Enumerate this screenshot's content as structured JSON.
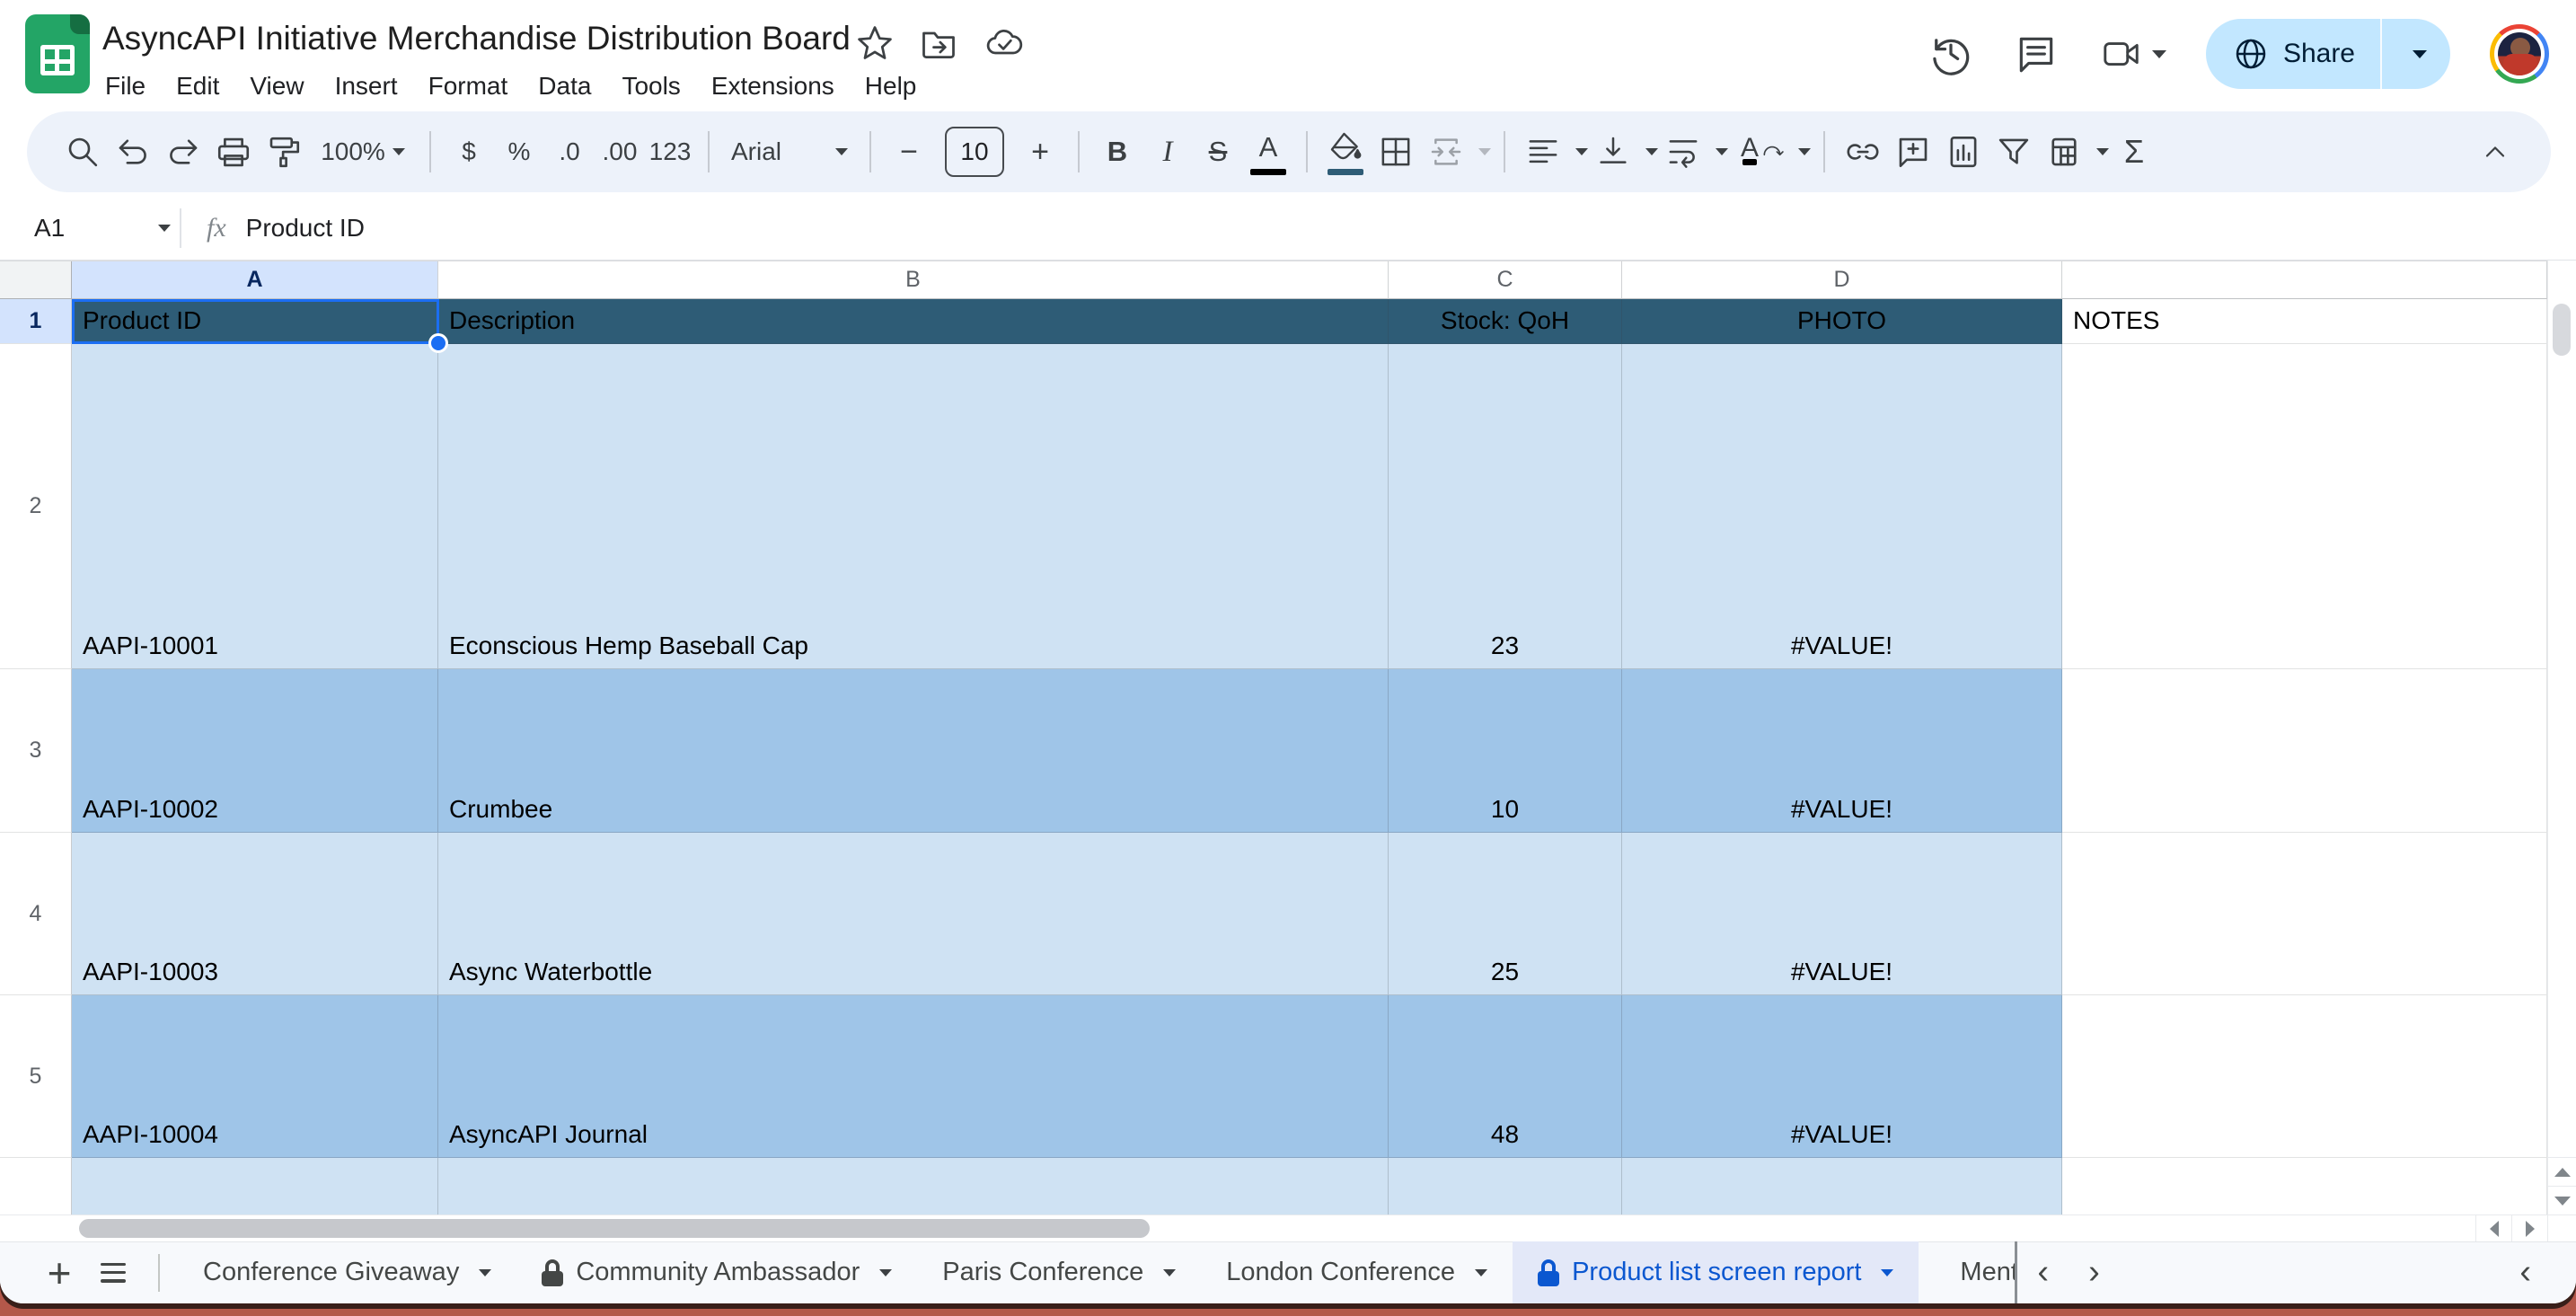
{
  "titlebar": {
    "title": "AsyncAPI Initiative Merchandise Distribution Board",
    "menus": [
      "File",
      "Edit",
      "View",
      "Insert",
      "Format",
      "Data",
      "Tools",
      "Extensions",
      "Help"
    ],
    "share_label": "Share"
  },
  "toolbar": {
    "zoom": "100%",
    "currency": "$",
    "percent": "%",
    "decrease_decimal": ".0",
    "increase_decimal": ".00",
    "more_formats": "123",
    "font_name": "Arial",
    "minus": "−",
    "font_size": "10",
    "plus": "+",
    "bold": "B",
    "italic": "I",
    "strikethrough": "S",
    "text_color_letter": "A",
    "rotate_letter": "A",
    "sum": "Σ"
  },
  "formula_bar": {
    "name_box": "A1",
    "fx_label": "fx",
    "value": "Product ID"
  },
  "grid": {
    "column_letters": [
      "A",
      "B",
      "C",
      "D"
    ],
    "row_numbers": [
      "1",
      "2",
      "3",
      "4",
      "5"
    ],
    "header_row": {
      "product_id": "Product ID",
      "description": "Description",
      "stock": "Stock: QoH",
      "photo": "PHOTO",
      "notes": "NOTES"
    },
    "rows": [
      {
        "id": "AAPI-10001",
        "description": "Econscious Hemp Baseball Cap",
        "stock": "23",
        "photo": "#VALUE!"
      },
      {
        "id": "AAPI-10002",
        "description": "Crumbee",
        "stock": "10",
        "photo": "#VALUE!"
      },
      {
        "id": "AAPI-10003",
        "description": "Async Waterbottle",
        "stock": "25",
        "photo": "#VALUE!"
      },
      {
        "id": "AAPI-10004",
        "description": "AsyncAPI Journal",
        "stock": "48",
        "photo": "#VALUE!"
      }
    ]
  },
  "tabs": {
    "add_label": "+",
    "items": [
      {
        "label": "Conference Giveaway"
      },
      {
        "label": "Community Ambassador"
      },
      {
        "label": "Paris Conference"
      },
      {
        "label": "London Conference"
      },
      {
        "label": "Product list screen report"
      },
      {
        "label": "Ment"
      }
    ]
  },
  "colors": {
    "header_row_bg": "#2e5c76",
    "row_light": "#cfe2f3",
    "row_medium": "#9fc5e8",
    "selection_blue": "#1b6ef3",
    "header_highlight": "#d3e3fd",
    "active_tab_text": "#0b57d0",
    "active_tab_bg": "#e3e8f8",
    "share_bg": "#c2e7ff"
  }
}
